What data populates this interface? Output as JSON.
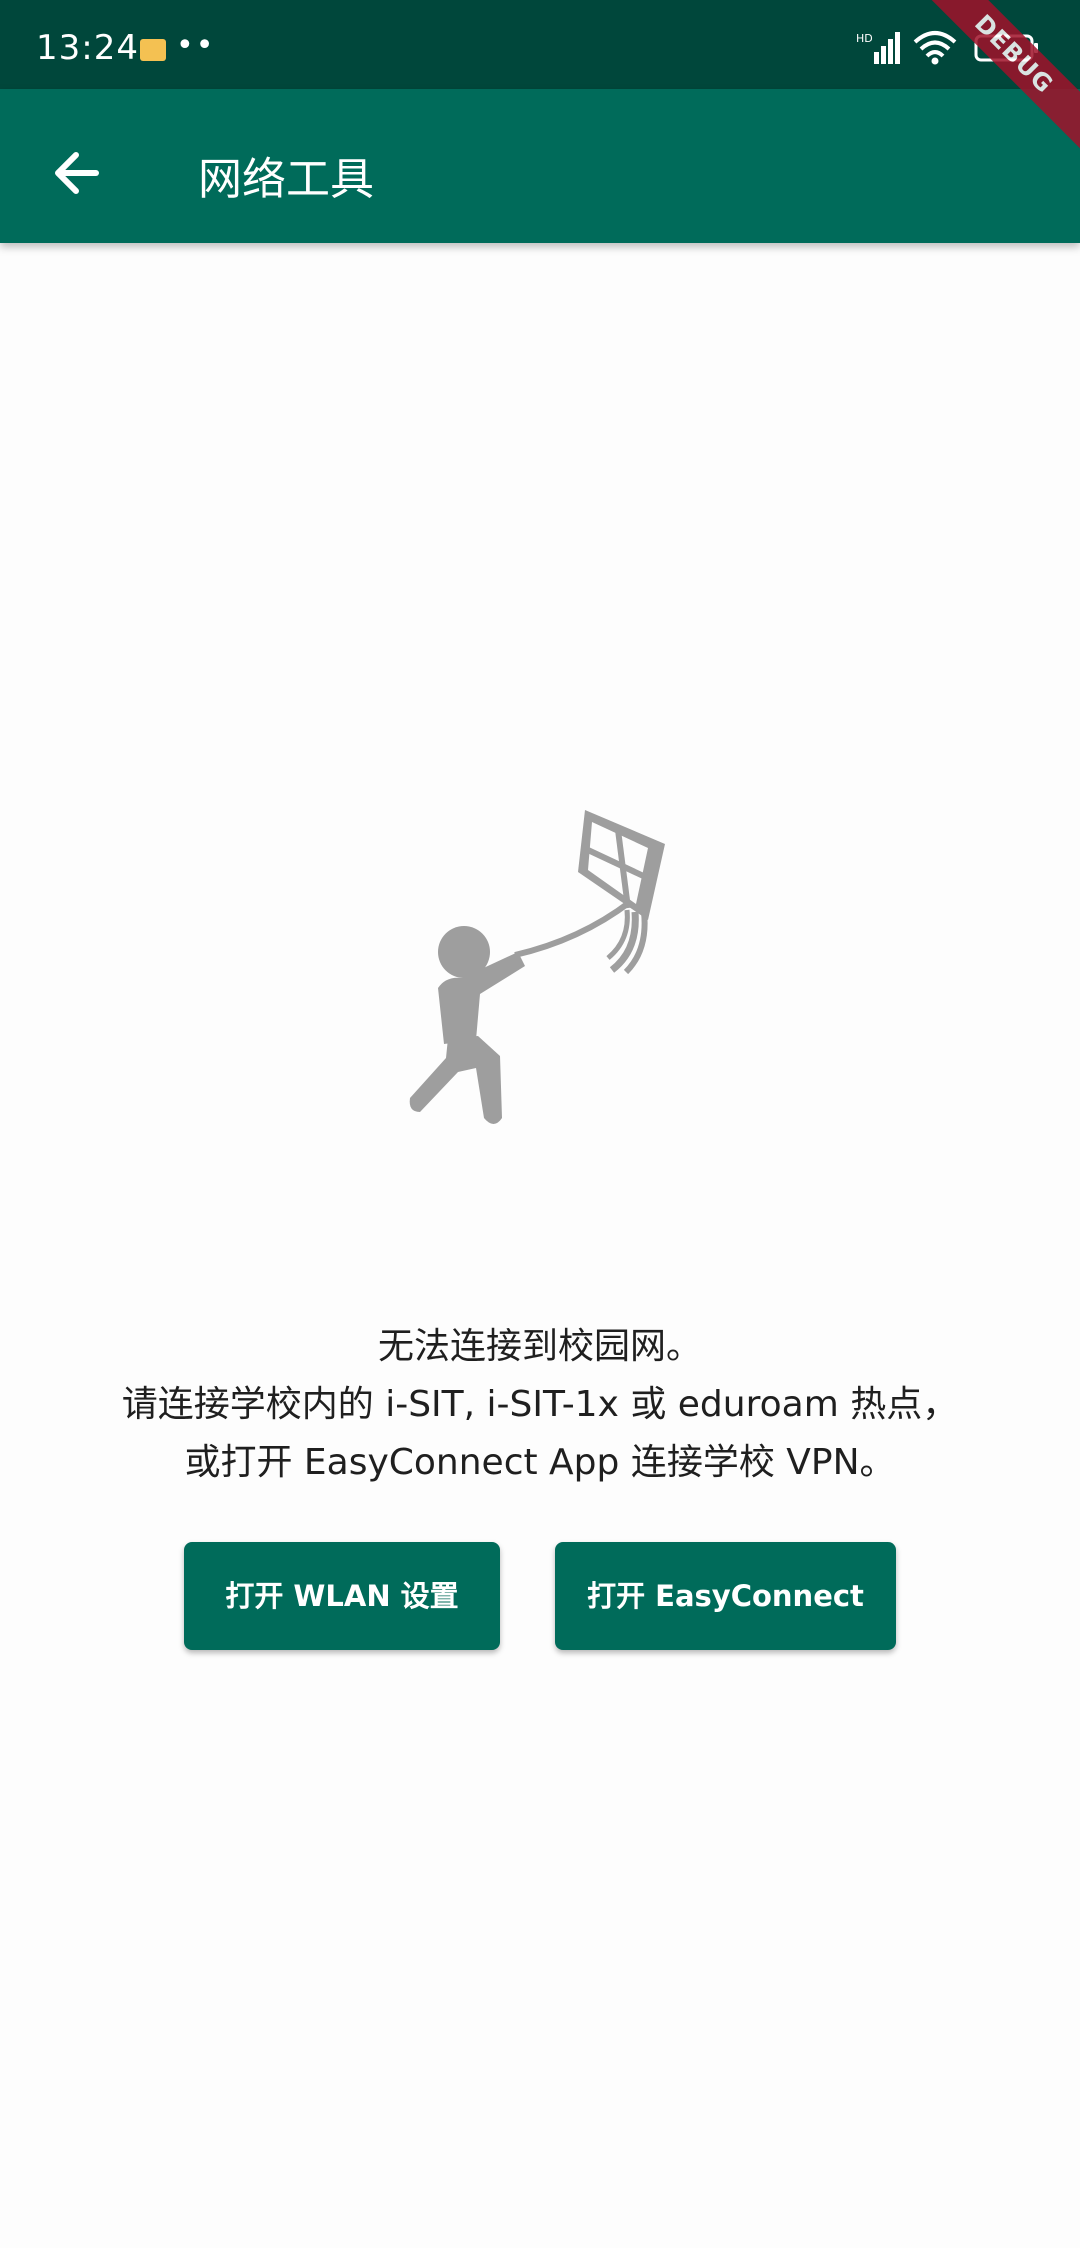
{
  "status_bar": {
    "time": "13:24",
    "notification_dots": "••",
    "network_type": "HD",
    "icons": [
      "message-icon",
      "signal-icon",
      "wifi-icon",
      "battery-icon"
    ]
  },
  "debug_banner": "DEBUG",
  "app_bar": {
    "title": "网络工具",
    "back_icon": "arrow-back-icon"
  },
  "illustration": {
    "icon": "kite-flying-person-icon",
    "color": "#9e9e9e"
  },
  "message": {
    "line1": "无法连接到校园网。",
    "line2": "请连接学校内的 i-SIT, i-SIT-1x 或 eduroam 热点，",
    "line3": "或打开 EasyConnect App 连接学校 VPN。"
  },
  "buttons": {
    "open_wlan": "打开 WLAN 设置",
    "open_easyconnect": "打开 EasyConnect"
  },
  "colors": {
    "status_bar": "#00473b",
    "primary": "#006b5a",
    "background": "#fdfdfd"
  }
}
